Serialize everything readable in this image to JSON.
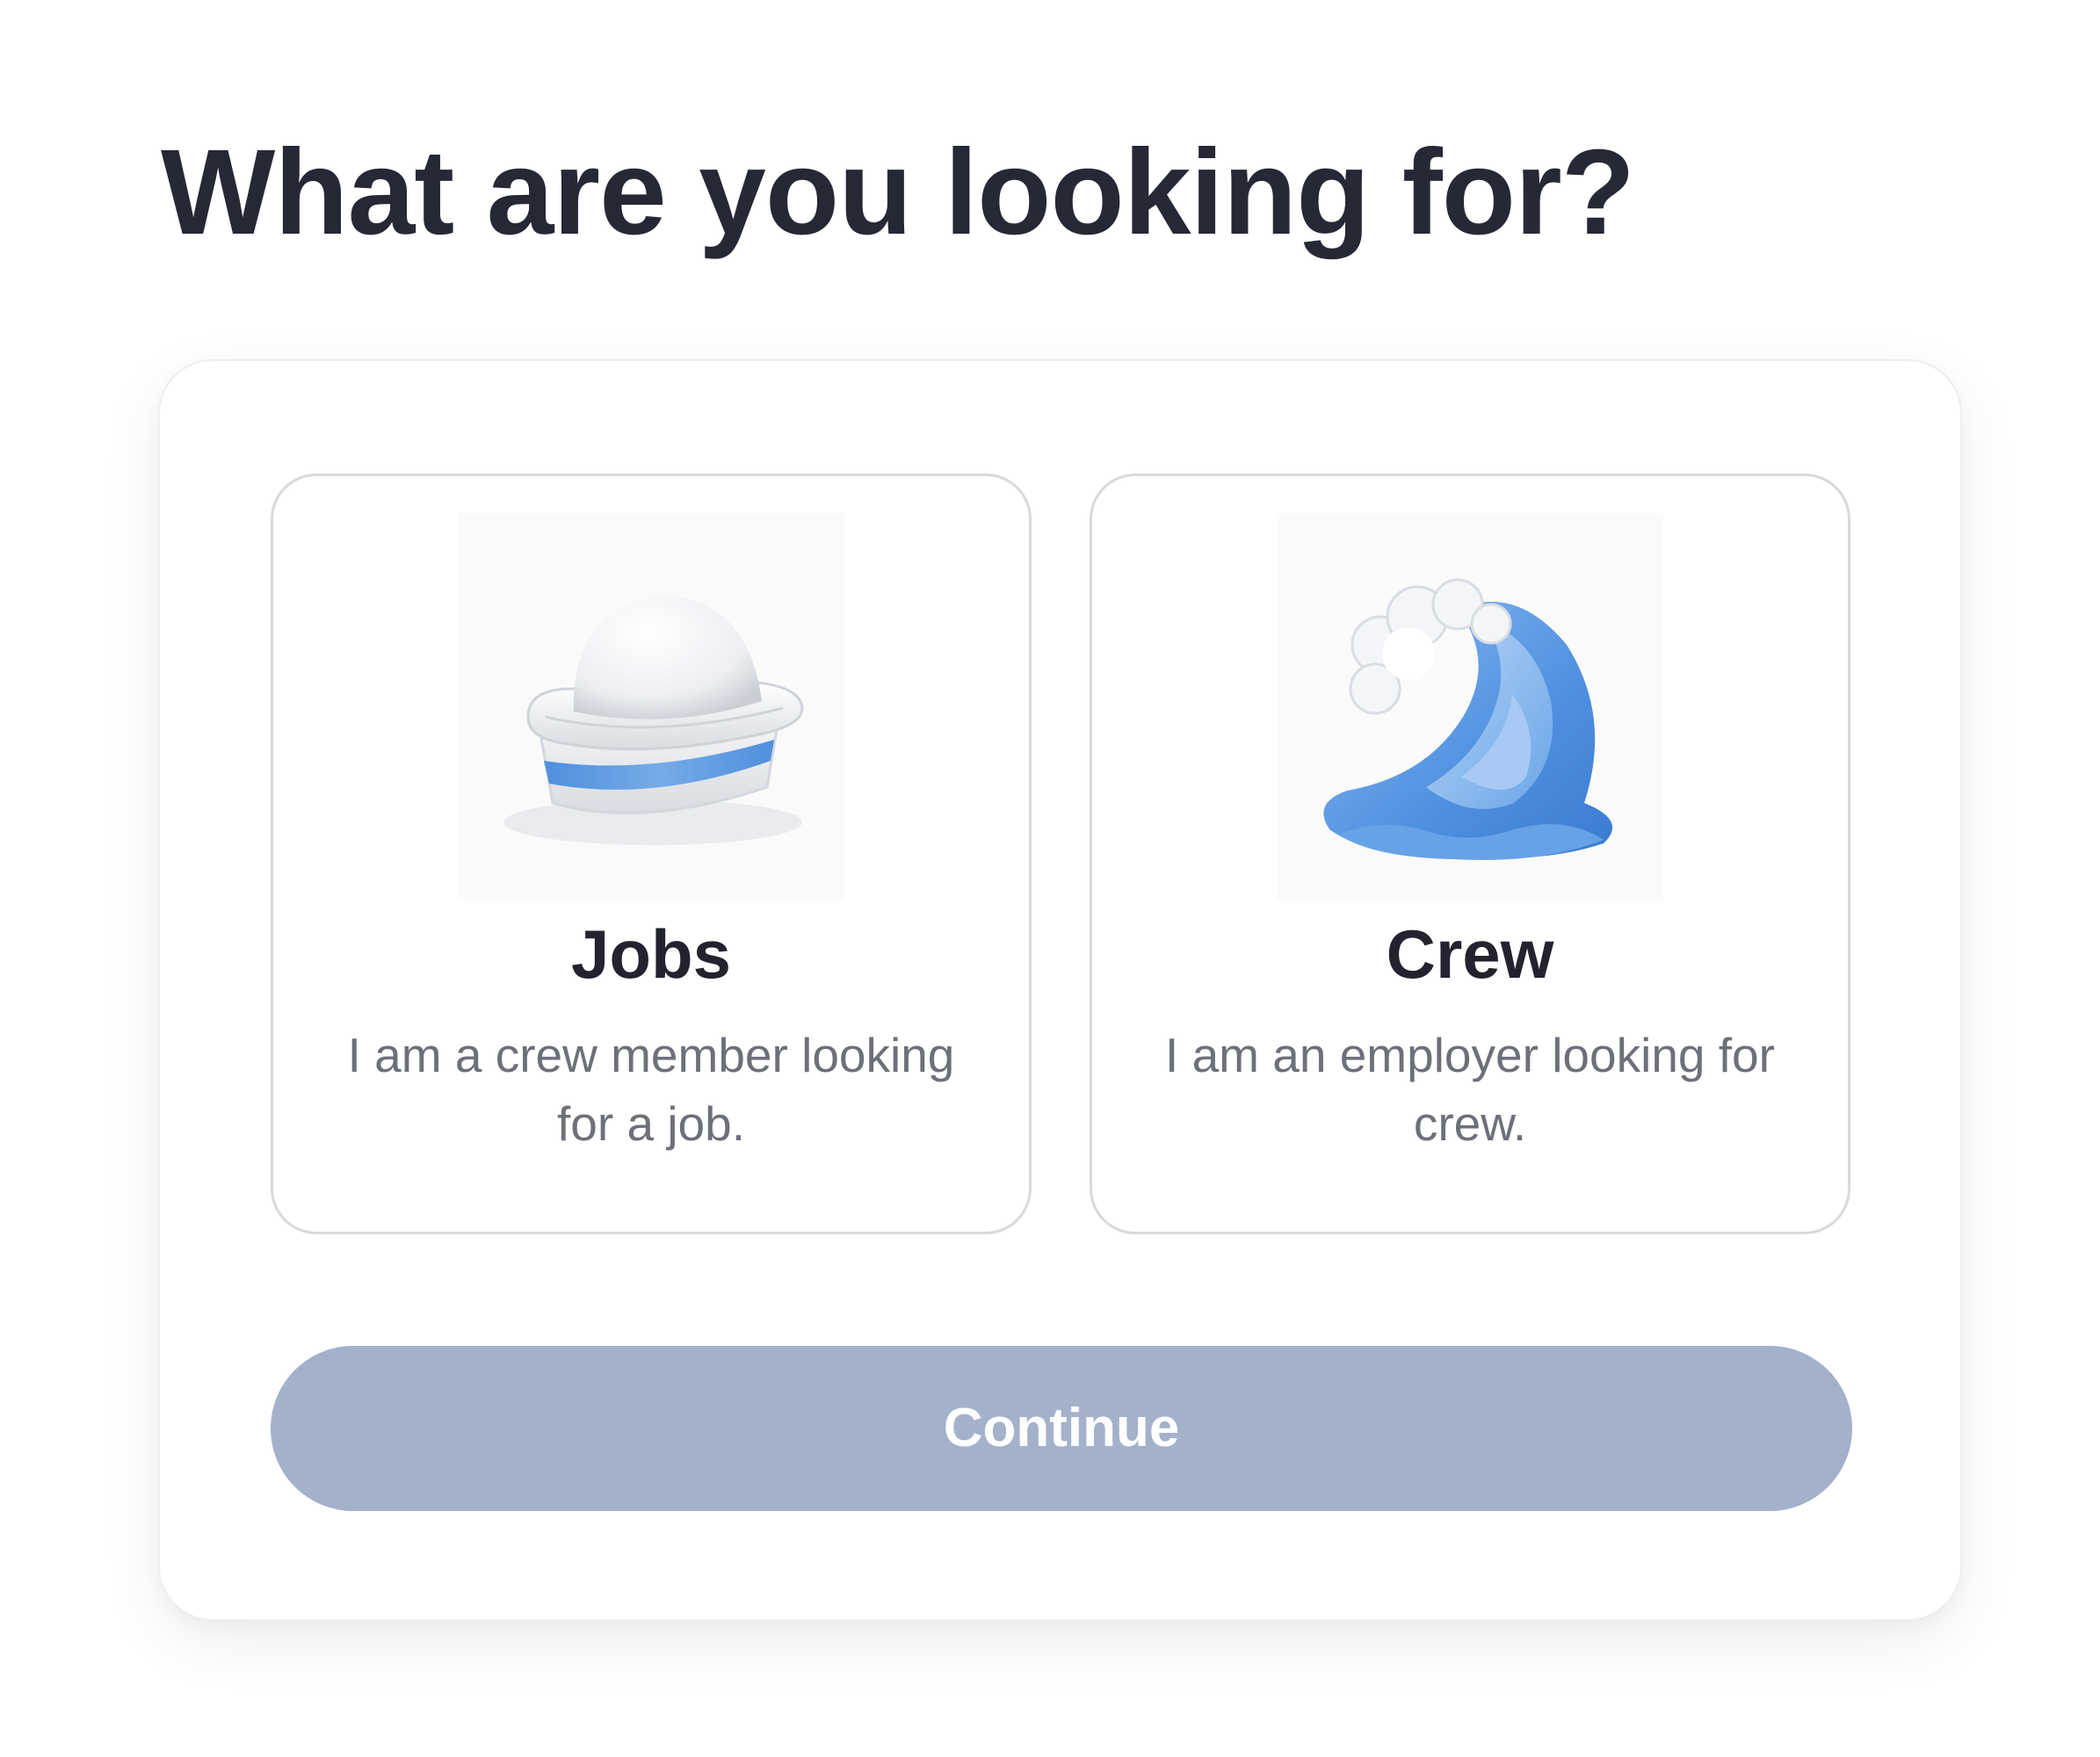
{
  "page": {
    "title": "What are you looking for?"
  },
  "options": [
    {
      "id": "jobs",
      "icon": "sailor-hat-icon",
      "title": "Jobs",
      "description": "I am a crew member looking for a job."
    },
    {
      "id": "crew",
      "icon": "wave-icon",
      "title": "Crew",
      "description": "I am an employer looking for crew."
    }
  ],
  "continue_button": {
    "label": "Continue",
    "disabled": true
  },
  "colors": {
    "title_text": "#262836",
    "card_border": "#d7d9dd",
    "description_text": "#6d7079",
    "button_disabled_bg": "#a3b1cb",
    "button_text": "#ffffff",
    "accent_blue": "#5b9be2"
  }
}
